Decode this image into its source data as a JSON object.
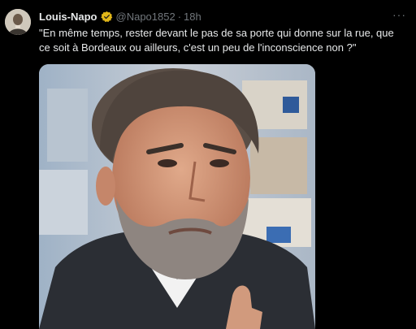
{
  "post": {
    "author_name": "Louis-Napo",
    "handle": "@Napo1852",
    "separator": "·",
    "time": "18h",
    "more_label": "···",
    "text": "\"En même temps, rester devant le pas de sa porte qui donne sur la rue, que ce soit à Bordeaux ou ailleurs, c'est un peu de l'inconscience non ?\"",
    "badge_color": "#e2b719",
    "avatar_icon": "avatar-portrait-icon",
    "verified_icon": "verified-badge-icon",
    "media_type": "video-thumbnail"
  },
  "colors": {
    "background": "#000000",
    "text_primary": "#e7e9ea",
    "text_secondary": "#71767b"
  }
}
